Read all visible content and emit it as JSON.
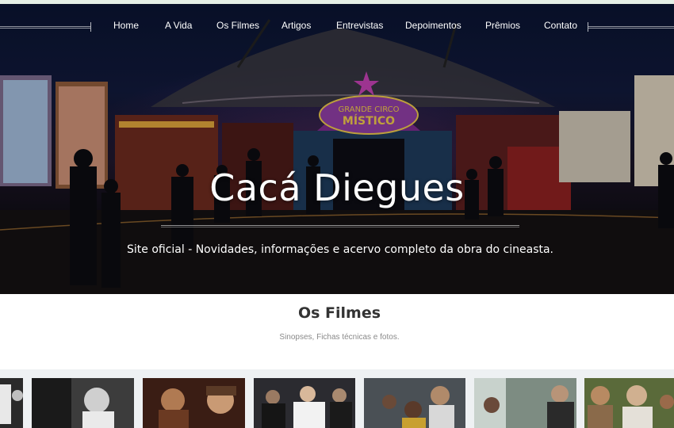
{
  "nav": {
    "items": [
      {
        "label": "Home"
      },
      {
        "label": "A Vida"
      },
      {
        "label": "Os Filmes"
      },
      {
        "label": "Artigos"
      },
      {
        "label": "Entrevistas"
      },
      {
        "label": "Depoimentos"
      },
      {
        "label": "Prêmios"
      },
      {
        "label": "Contato"
      }
    ]
  },
  "hero": {
    "title": "Cacá Diegues",
    "subtitle": "Site oficial - Novidades, informações e acervo completo da obra do cineasta.",
    "sign_line1": "GRANDE CIRCO",
    "sign_line2": "MÍSTICO"
  },
  "films": {
    "title": "Os Filmes",
    "subtitle": "Sinopses, Fichas técnicas e fotos."
  }
}
